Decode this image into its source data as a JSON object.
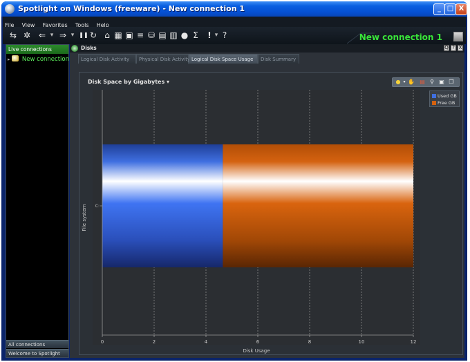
{
  "window": {
    "title": "Spotlight on Windows (freeware) - New connection 1",
    "controls": {
      "minimize": "_",
      "maximize": "□",
      "close": "X"
    }
  },
  "menu": [
    "File",
    "View",
    "Favorites",
    "Tools",
    "Help"
  ],
  "toolbar": {
    "connection_label": "New connection 1",
    "buttons": [
      {
        "icon": "connect-icon",
        "glyph": "⇆"
      },
      {
        "icon": "disconnect-icon",
        "glyph": "✲"
      },
      {
        "icon": "back-icon",
        "glyph": "⇐"
      },
      {
        "icon": "forward-icon",
        "glyph": "⇒"
      },
      {
        "icon": "pause-icon",
        "glyph": "❚❚"
      },
      {
        "icon": "refresh-icon",
        "glyph": "↻"
      },
      {
        "icon": "home-icon",
        "glyph": "⌂"
      },
      {
        "icon": "grid-icon",
        "glyph": "▦"
      },
      {
        "icon": "window-icon",
        "glyph": "▣"
      },
      {
        "icon": "stack-icon",
        "glyph": "≡"
      },
      {
        "icon": "database-icon",
        "glyph": "⛁"
      },
      {
        "icon": "dashboard-icon",
        "glyph": "▤"
      },
      {
        "icon": "bar-chart-icon",
        "glyph": "▥"
      },
      {
        "icon": "globe-icon",
        "glyph": "●"
      },
      {
        "icon": "sum-icon",
        "glyph": "Σ"
      },
      {
        "icon": "alert-icon",
        "glyph": "!"
      },
      {
        "icon": "help-icon",
        "glyph": "?"
      }
    ]
  },
  "sidebar": {
    "header": "Live connections",
    "connection": "New connection 1",
    "bottom_tabs": [
      "All connections",
      "Welcome to Spotlight"
    ]
  },
  "panel": {
    "title": "Disks",
    "header_buttons": [
      "Q",
      "?",
      "X"
    ],
    "tabs": [
      {
        "label": "Logical Disk Activity",
        "active": false
      },
      {
        "label": "Physical Disk Activity",
        "active": false
      },
      {
        "label": "Logical Disk Space Usage",
        "active": true
      },
      {
        "label": "Disk Summary",
        "active": false
      }
    ]
  },
  "chart_tools": [
    "zoom-icon",
    "hand-icon",
    "export-icon",
    "pin-icon",
    "save-icon",
    "copy-icon"
  ],
  "colors": {
    "used": "#3f6fe0",
    "free": "#d46210",
    "plot_bg": "#2b2e32",
    "grid": "#8a8a8a"
  },
  "chart_data": {
    "type": "bar",
    "orientation": "horizontal",
    "stacked": true,
    "title": "Disk Space by Gigabytes",
    "categories": [
      "C:"
    ],
    "series": [
      {
        "name": "Used GB",
        "values": [
          4.65
        ]
      },
      {
        "name": "Free GB",
        "values": [
          7.35
        ]
      }
    ],
    "xlabel": "Disk Usage",
    "ylabel": "File system",
    "xlim": [
      0,
      12
    ],
    "xticks": [
      0,
      2,
      4,
      6,
      8,
      10,
      12
    ],
    "grid": true,
    "legend": "top-right"
  }
}
